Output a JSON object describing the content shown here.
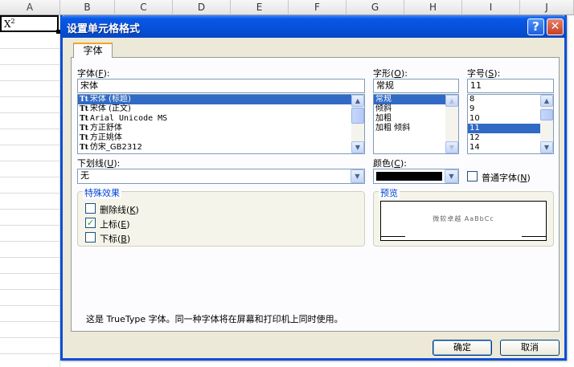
{
  "spreadsheet": {
    "columns": [
      "A",
      "B",
      "C",
      "D",
      "E",
      "F",
      "G",
      "H",
      "I",
      "J"
    ],
    "cell_a1": {
      "base": "X",
      "superscript": "2"
    }
  },
  "dialog": {
    "title": "设置单元格格式",
    "help_label": "?",
    "close_label": "✕",
    "tabs": [
      "字体"
    ],
    "font": {
      "label": "字体(",
      "accel": "F",
      "label_end": "):",
      "value": "宋体",
      "items": [
        {
          "icon": "Tt",
          "text": "宋体 (标题)",
          "selected": true
        },
        {
          "icon": "Tt",
          "text": "宋体 (正文)",
          "selected": false
        },
        {
          "icon": "Tt",
          "text": "Arial Unicode MS",
          "selected": false
        },
        {
          "icon": "Tt",
          "text": "方正舒体",
          "selected": false
        },
        {
          "icon": "Tt",
          "text": "方正姚体",
          "selected": false
        },
        {
          "icon": "Tt",
          "text": "仿宋_GB2312",
          "selected": false
        }
      ]
    },
    "style": {
      "label": "字形(",
      "accel": "O",
      "label_end": "):",
      "value": "常规",
      "items": [
        "常规",
        "倾斜",
        "加粗",
        "加粗 倾斜"
      ],
      "selected_index": 0
    },
    "size": {
      "label": "字号(",
      "accel": "S",
      "label_end": "):",
      "value": "11",
      "items": [
        "8",
        "9",
        "10",
        "11",
        "12",
        "14"
      ],
      "selected_index": 3
    },
    "underline": {
      "label": "下划线(",
      "accel": "U",
      "label_end": "):",
      "value": "无"
    },
    "color": {
      "label": "颜色(",
      "accel": "C",
      "label_end": "):",
      "value": "#000000"
    },
    "normal_font": {
      "label": "普通字体(",
      "accel": "N",
      "label_end": ")",
      "checked": false
    },
    "effects": {
      "title": "特殊效果",
      "strikethrough": {
        "label": "删除线(",
        "accel": "K",
        "label_end": ")",
        "checked": false
      },
      "superscript": {
        "label": "上标(",
        "accel": "E",
        "label_end": ")",
        "checked": true
      },
      "subscript": {
        "label": "下标(",
        "accel": "B",
        "label_end": ")",
        "checked": false
      }
    },
    "preview": {
      "title": "预览",
      "sample": "微软卓越 AaBbCc"
    },
    "info_text": "这是 TrueType 字体。同一种字体将在屏幕和打印机上同时使用。",
    "ok_label": "确定",
    "cancel_label": "取消",
    "accent_color": "#0a58e8"
  }
}
